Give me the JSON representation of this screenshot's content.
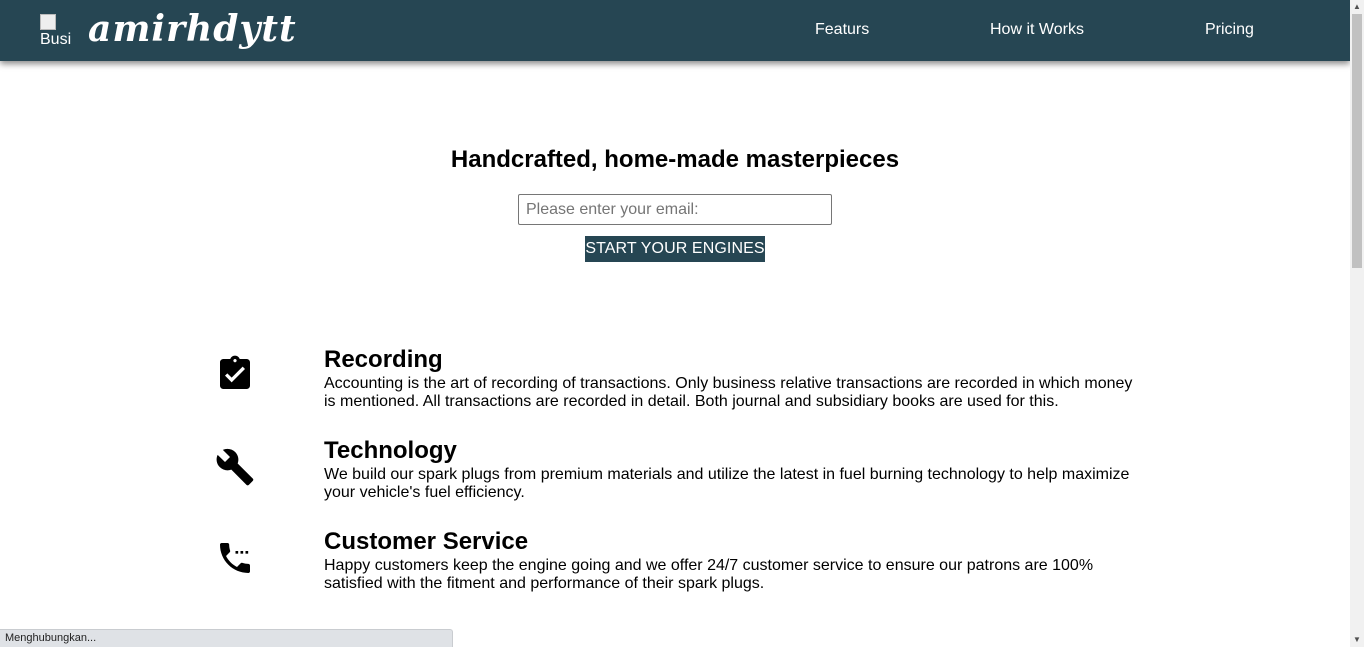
{
  "header": {
    "logo_alt": "Busi",
    "brand": "amirhdytt",
    "nav": [
      "Featurs",
      "How it Works",
      "Pricing"
    ]
  },
  "hero": {
    "title": "Handcrafted, home-made masterpieces",
    "email_placeholder": "Please enter your email:",
    "email_value": "",
    "cta_label": "START YOUR ENGINES"
  },
  "features": [
    {
      "icon": "clipboard-check-icon",
      "title": "Recording",
      "description": "Accounting is the art of recording of transactions. Only business relative transactions are recorded in which money is mentioned. All transactions are recorded in detail. Both journal and subsidiary books are used for this."
    },
    {
      "icon": "wrench-icon",
      "title": "Technology",
      "description": "We build our spark plugs from premium materials and utilize the latest in fuel burning technology to help maximize your vehicle's fuel efficiency."
    },
    {
      "icon": "phone-in-talk-icon",
      "title": "Customer Service",
      "description": "Happy customers keep the engine going and we offer 24/7 customer service to ensure our patrons are 100% satisfied with the fitment and performance of their spark plugs."
    }
  ],
  "status_bar": {
    "text": "Menghubungkan..."
  },
  "colors": {
    "header_bg": "#264653",
    "button_bg": "#264653",
    "text": "#000000"
  }
}
